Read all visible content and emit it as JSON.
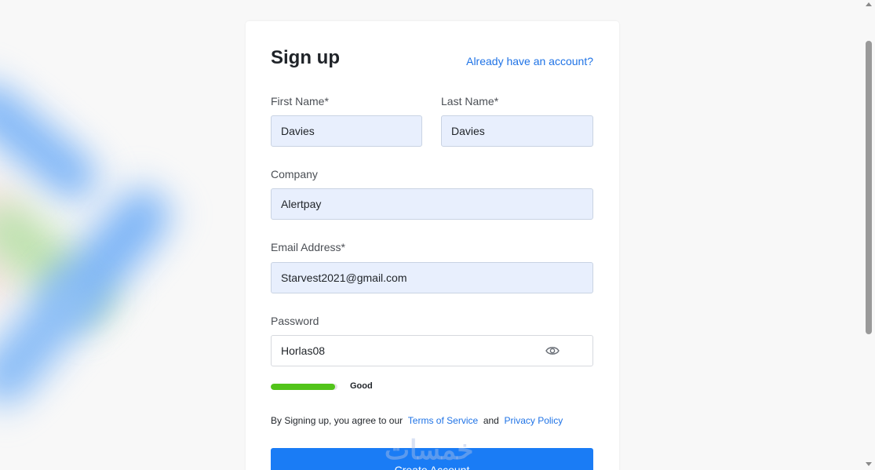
{
  "form": {
    "title": "Sign up",
    "signin_link": "Already have an account?",
    "first_name": {
      "label": "First Name*",
      "value": "Davies"
    },
    "last_name": {
      "label": "Last Name*",
      "value": "Davies"
    },
    "company": {
      "label": "Company",
      "value": "Alertpay"
    },
    "email": {
      "label": "Email Address*",
      "value": "Starvest2021@gmail.com"
    },
    "password": {
      "label": "Password",
      "value": "Horlas08",
      "toggle_icon": "eye-icon",
      "strength_label": "Good",
      "strength_fraction": 0.96,
      "strength_color": "#52c41a"
    },
    "terms": {
      "prefix": "By Signing up, you agree to our",
      "tos_link": "Terms of Service",
      "and": "and",
      "privacy_link": "Privacy Policy"
    },
    "submit_label": "Create Account",
    "watermark": "خمسات"
  },
  "colors": {
    "accent": "#1a7cf5",
    "link": "#1f73e6",
    "input_bg": "#e8effd"
  }
}
